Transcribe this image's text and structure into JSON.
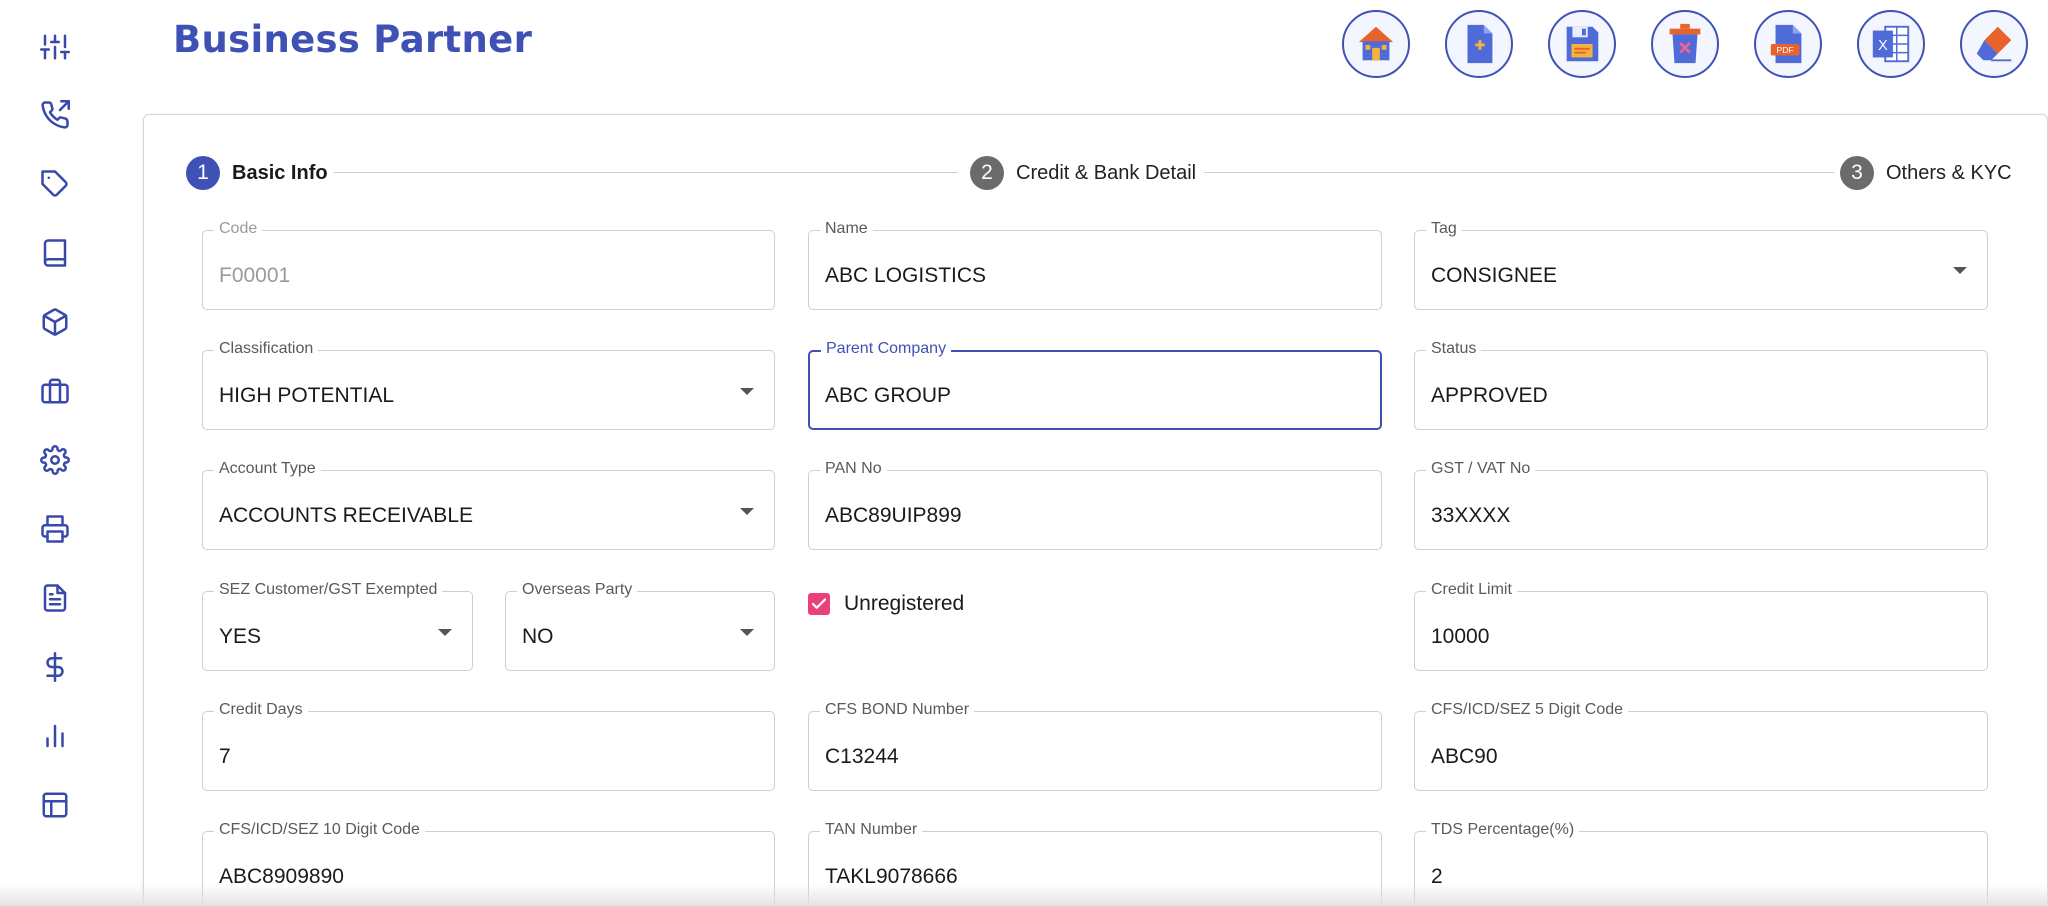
{
  "header": {
    "title": "Business Partner"
  },
  "sidebar": {
    "items": [
      {
        "icon": "sliders-icon"
      },
      {
        "icon": "phone-outgoing-icon"
      },
      {
        "icon": "tag-icon"
      },
      {
        "icon": "book-icon"
      },
      {
        "icon": "package-icon"
      },
      {
        "icon": "briefcase-icon"
      },
      {
        "icon": "gear-icon"
      },
      {
        "icon": "printer-icon"
      },
      {
        "icon": "document-icon"
      },
      {
        "icon": "dollar-icon"
      },
      {
        "icon": "bar-chart-icon"
      },
      {
        "icon": "layout-icon"
      }
    ]
  },
  "toolbar": {
    "buttons": [
      {
        "name": "home-button",
        "icon": "home-icon"
      },
      {
        "name": "new-document-button",
        "icon": "new-document-icon"
      },
      {
        "name": "save-button",
        "icon": "floppy-disk-icon"
      },
      {
        "name": "delete-button",
        "icon": "trash-icon"
      },
      {
        "name": "export-pdf-button",
        "icon": "pdf-icon"
      },
      {
        "name": "export-excel-button",
        "icon": "excel-icon"
      },
      {
        "name": "clear-button",
        "icon": "eraser-icon"
      }
    ],
    "pdf_text": "PDF",
    "excel_text": "X"
  },
  "stepper": {
    "steps": [
      {
        "number": "1",
        "label": "Basic Info",
        "active": true
      },
      {
        "number": "2",
        "label": "Credit & Bank Detail",
        "active": false
      },
      {
        "number": "3",
        "label": "Others & KYC",
        "active": false
      }
    ]
  },
  "form": {
    "code": {
      "label": "Code",
      "value": "F00001"
    },
    "name": {
      "label": "Name",
      "value": "ABC LOGISTICS"
    },
    "tag": {
      "label": "Tag",
      "value": "CONSIGNEE"
    },
    "classification": {
      "label": "Classification",
      "value": "HIGH POTENTIAL"
    },
    "parent_company": {
      "label": "Parent Company",
      "value": "ABC GROUP"
    },
    "status": {
      "label": "Status",
      "value": "APPROVED"
    },
    "account_type": {
      "label": "Account Type",
      "value": "ACCOUNTS RECEIVABLE"
    },
    "pan_no": {
      "label": "PAN No",
      "value": "ABC89UIP899"
    },
    "gst_vat_no": {
      "label": "GST / VAT No",
      "value": "33XXXX"
    },
    "sez_customer": {
      "label": "SEZ Customer/GST Exempted",
      "value": "YES"
    },
    "overseas_party": {
      "label": "Overseas Party",
      "value": "NO"
    },
    "unregistered": {
      "label": "Unregistered",
      "checked": true
    },
    "credit_limit": {
      "label": "Credit Limit",
      "value": "10000"
    },
    "credit_days": {
      "label": "Credit Days",
      "value": "7"
    },
    "cfs_bond_number": {
      "label": "CFS BOND Number",
      "value": "C13244"
    },
    "cfs_5_digit": {
      "label": "CFS/ICD/SEZ 5 Digit Code",
      "value": "ABC90"
    },
    "cfs_10_digit": {
      "label": "CFS/ICD/SEZ 10 Digit Code",
      "value": "ABC8909890"
    },
    "tan_number": {
      "label": "TAN Number",
      "value": "TAKL9078666"
    },
    "tds_percentage": {
      "label": "TDS Percentage(%)",
      "value": "2"
    }
  },
  "colors": {
    "primary": "#3f51b5",
    "checkbox": "#ec407a",
    "inactive_step": "#6b6b6b"
  }
}
